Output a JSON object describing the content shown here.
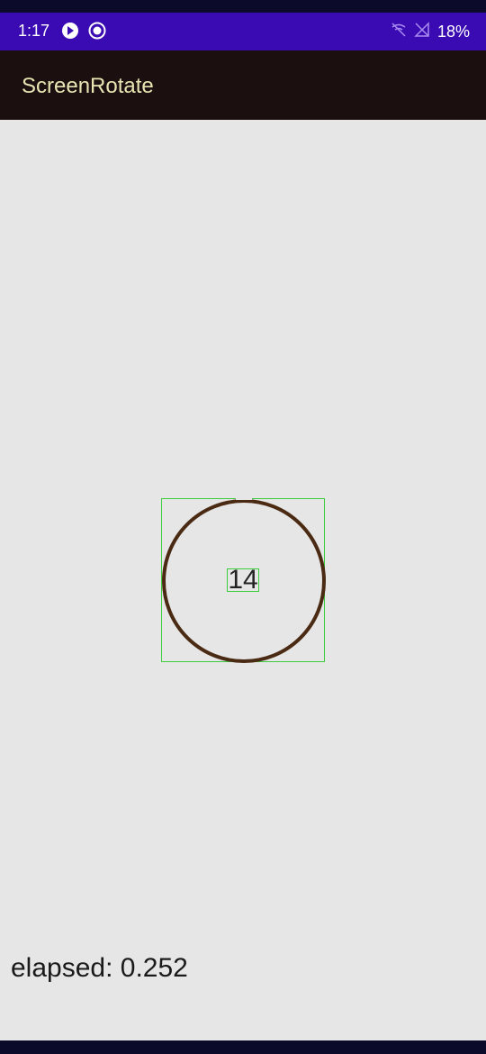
{
  "status_bar": {
    "time": "1:17",
    "battery": "18%",
    "icons": [
      "play-store-icon",
      "record-icon",
      "wifi-off-icon",
      "signal-off-icon"
    ]
  },
  "app_bar": {
    "title": "ScreenRotate"
  },
  "main": {
    "counter": "14",
    "elapsed_text": "elapsed: 0.252"
  },
  "colors": {
    "status_bar": "#3a0ab2",
    "app_bar": "#1b0f0f",
    "title": "#e9e4b2",
    "circle": "#4a2a12",
    "guide": "#3ecb3e",
    "background": "#e6e6e6"
  }
}
